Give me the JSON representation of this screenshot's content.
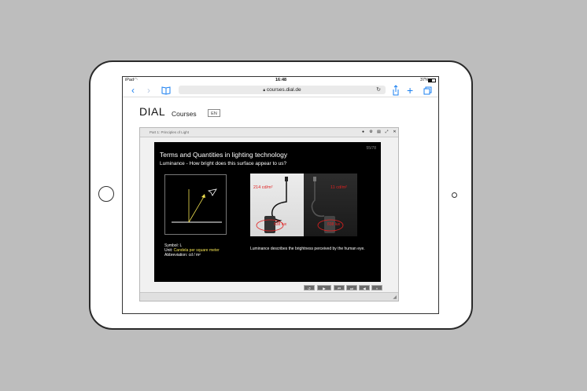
{
  "status_bar": {
    "device": "iPad",
    "time": "16:48",
    "battery": "37%"
  },
  "browser": {
    "url": "courses.dial.de",
    "icons": [
      "back-icon",
      "forward-icon",
      "bookmarks-icon",
      "reload-icon",
      "share-icon",
      "new-tab-icon",
      "tabs-icon"
    ]
  },
  "site": {
    "logo": "DIAL",
    "nav_courses": "Courses",
    "lang": "EN"
  },
  "player": {
    "part_label": "Part 1: Principles of Light",
    "controls_top": [
      "info-icon",
      "settings-icon",
      "print-icon",
      "fullscreen-icon",
      "close-icon"
    ],
    "controls_bottom": [
      "replay-icon",
      "play-icon",
      "skip-back-icon",
      "skip-forward-icon",
      "volume-icon",
      "collapse-icon"
    ]
  },
  "slide": {
    "title": "Terms and Quantities in lighting technology",
    "subtitle": "Luminance - How bright does this surface appear to us?",
    "page_num": "55/78",
    "left_value": "214 cd/m²",
    "right_value": "11 cd/m²",
    "lux_left": "838 lux",
    "lux_right": "838 lux",
    "symbol": "Symbol: L",
    "unit_prefix": "Unit: ",
    "unit": "Candela per square meter",
    "abbreviation": "Abbreviation: cd / m²",
    "description": "Luminance describes the brightness perceived by the human eye."
  },
  "colors": {
    "accent": "#1a7ff0",
    "highlight": "#e02020",
    "unit_text": "#f0e050"
  }
}
